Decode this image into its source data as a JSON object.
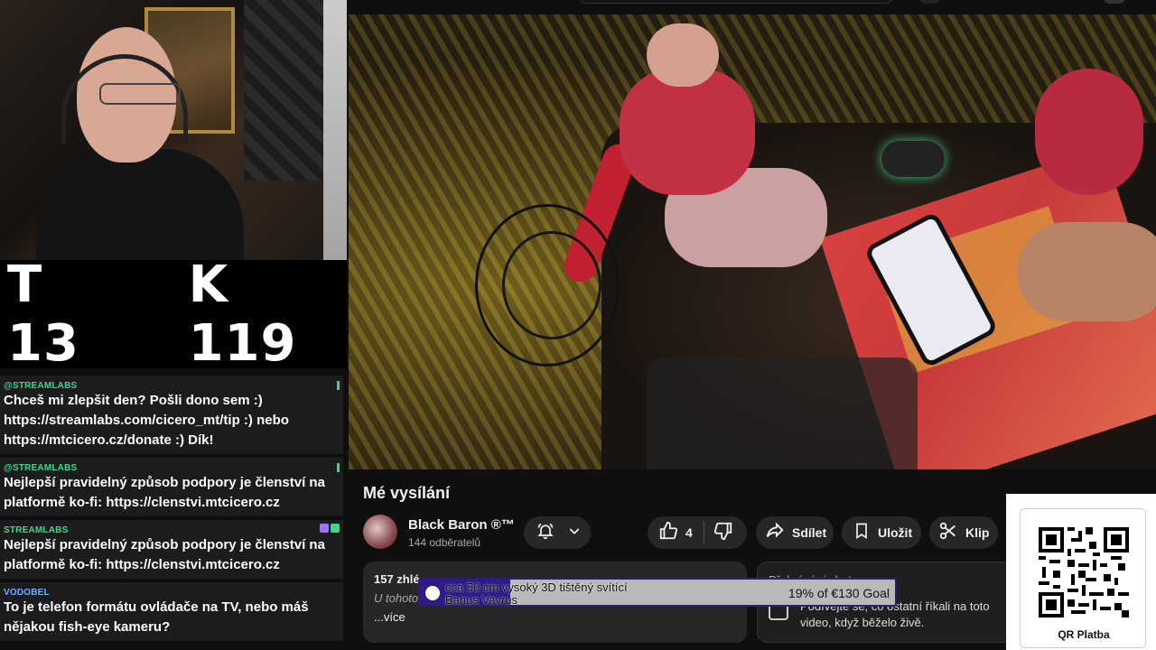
{
  "counter": {
    "t": "T 13",
    "k": "K 119"
  },
  "chat": [
    {
      "author": "@STREAMLABS",
      "text": "Chceš mi zlepšit den? Pošli dono sem :) https://streamlabs.com/cicero_mt/tip :) nebo https://mtcicero.cz/donate :) Dík!"
    },
    {
      "author": "@STREAMLABS",
      "text": "Nejlepší pravidelný způsob podpory je členství na platformě ko-fi: https://clenstvi.mtcicero.cz"
    },
    {
      "author": "STREAMLABS",
      "text": "Nejlepší pravidelný způsob podpory je členství na platformě ko-fi: https://clenstvi.mtcicero.cz"
    },
    {
      "author": "VODOBEL",
      "text": "To je telefon formátu ovládače na TV, nebo máš nějakou fish-eye kameru?"
    }
  ],
  "video": {
    "title": "Mé vysílání",
    "channel": "Black Baron ®™",
    "subscribers": "144 odběratelů",
    "likes": "4",
    "share": "Sdílet",
    "save": "Uložit",
    "clip": "Klip",
    "views_prefix": "157 zhlé",
    "desc_snippet": "U tohoto",
    "more": "...více",
    "replay_title": "Přehrávání chatu",
    "replay_text": "Podívejte se, co ostatní říkali na toto video, když běželo živě."
  },
  "banner": {
    "line1": "cca 50 cm vysoký 3D tištěný svítící",
    "line2": "Banus Vavrus",
    "goal": "19% of €130 Goal",
    "progress": 0.19
  },
  "qr": {
    "label": "QR Platba"
  },
  "icons": [
    "bell-icon",
    "chevron-down-icon",
    "thumbs-up-icon",
    "thumbs-down-icon",
    "share-icon",
    "bookmark-icon",
    "scissors-icon",
    "chat-icon",
    "qr-code-icon"
  ]
}
